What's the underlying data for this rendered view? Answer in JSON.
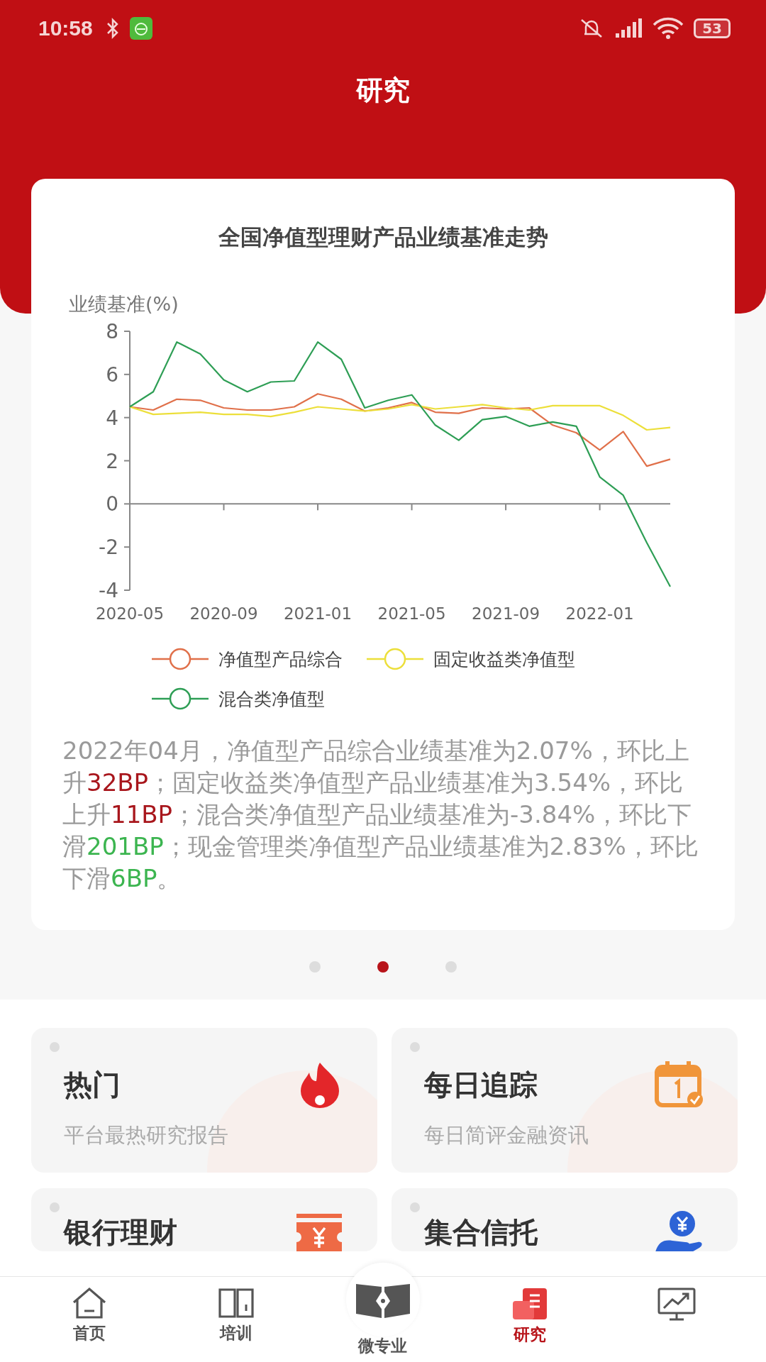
{
  "status_bar": {
    "time": "10:58",
    "battery": "53"
  },
  "header": {
    "title": "研究"
  },
  "chart_card": {
    "title": "全国净值型理财产品业绩基准走势",
    "chart_data": {
      "type": "line",
      "ylabel": "业绩基准(%)",
      "x": [
        "2020-05",
        "2020-06",
        "2020-07",
        "2020-08",
        "2020-09",
        "2020-10",
        "2020-11",
        "2020-12",
        "2021-01",
        "2021-02",
        "2021-03",
        "2021-04",
        "2021-05",
        "2021-06",
        "2021-07",
        "2021-08",
        "2021-09",
        "2021-10",
        "2021-11",
        "2021-12",
        "2022-01",
        "2022-02",
        "2022-03",
        "2022-04"
      ],
      "xlim": [
        "2020-05",
        "2022-04"
      ],
      "ylim": [
        -4,
        8
      ],
      "yticks": [
        8,
        6,
        4,
        2,
        0,
        -2,
        -4
      ],
      "xticks": [
        "2020-05",
        "2020-09",
        "2021-01",
        "2021-05",
        "2021-09",
        "2022-01"
      ],
      "series": [
        {
          "name": "净值型产品综合",
          "color": "#e0704a",
          "values": [
            4.5,
            4.35,
            4.85,
            4.8,
            4.45,
            4.35,
            4.35,
            4.5,
            5.1,
            4.85,
            4.3,
            4.45,
            4.7,
            4.25,
            4.2,
            4.45,
            4.4,
            4.45,
            3.65,
            3.3,
            2.5,
            3.35,
            1.75,
            2.07
          ]
        },
        {
          "name": "固定收益类净值型",
          "color": "#ecdf3a",
          "values": [
            4.5,
            4.15,
            4.2,
            4.25,
            4.15,
            4.15,
            4.05,
            4.25,
            4.5,
            4.4,
            4.3,
            4.4,
            4.6,
            4.4,
            4.5,
            4.6,
            4.45,
            4.35,
            4.55,
            4.55,
            4.55,
            4.1,
            3.43,
            3.54
          ]
        },
        {
          "name": "混合类净值型",
          "color": "#2e9e55",
          "values": [
            4.5,
            5.2,
            7.5,
            6.95,
            5.75,
            5.2,
            5.65,
            5.7,
            7.5,
            6.7,
            4.45,
            4.8,
            5.05,
            3.65,
            2.95,
            3.9,
            4.05,
            3.6,
            3.8,
            3.6,
            1.25,
            0.4,
            -1.8,
            -3.84
          ]
        }
      ]
    },
    "summary": [
      {
        "kind": "plain",
        "text": "2022年04月，净值型产品综合业绩基准为2.07%，环比上升"
      },
      {
        "kind": "up",
        "text": "32BP"
      },
      {
        "kind": "plain",
        "text": "；固定收益类净值型产品业绩基准为3.54%，环比上升"
      },
      {
        "kind": "up",
        "text": "11BP"
      },
      {
        "kind": "plain",
        "text": "；混合类净值型产品业绩基准为-3.84%，环比下滑"
      },
      {
        "kind": "down",
        "text": "201BP"
      },
      {
        "kind": "plain",
        "text": "；现金管理类净值型产品业绩基准为2.83%，环比下滑"
      },
      {
        "kind": "down",
        "text": "6BP"
      },
      {
        "kind": "plain",
        "text": "。"
      }
    ]
  },
  "pager": [
    {
      "selected": false
    },
    {
      "selected": true
    },
    {
      "selected": false
    }
  ],
  "tiles": [
    {
      "kind": "fire",
      "title": "热门",
      "subtitle": "平台最热研究报告"
    },
    {
      "kind": "calendar",
      "title": "每日追踪",
      "subtitle": "每日简评金融资讯"
    },
    {
      "kind": "ticket",
      "title": "银行理财"
    },
    {
      "kind": "coin",
      "title": "集合信托"
    }
  ],
  "nav": [
    {
      "kind": "home",
      "label": "首页",
      "selected": false
    },
    {
      "kind": "book",
      "label": "培训",
      "selected": false
    },
    {
      "kind": "center",
      "label": "微专业",
      "selected": false
    },
    {
      "kind": "research",
      "label": "研究",
      "selected": true
    },
    {
      "kind": "chart",
      "selected": false
    }
  ]
}
